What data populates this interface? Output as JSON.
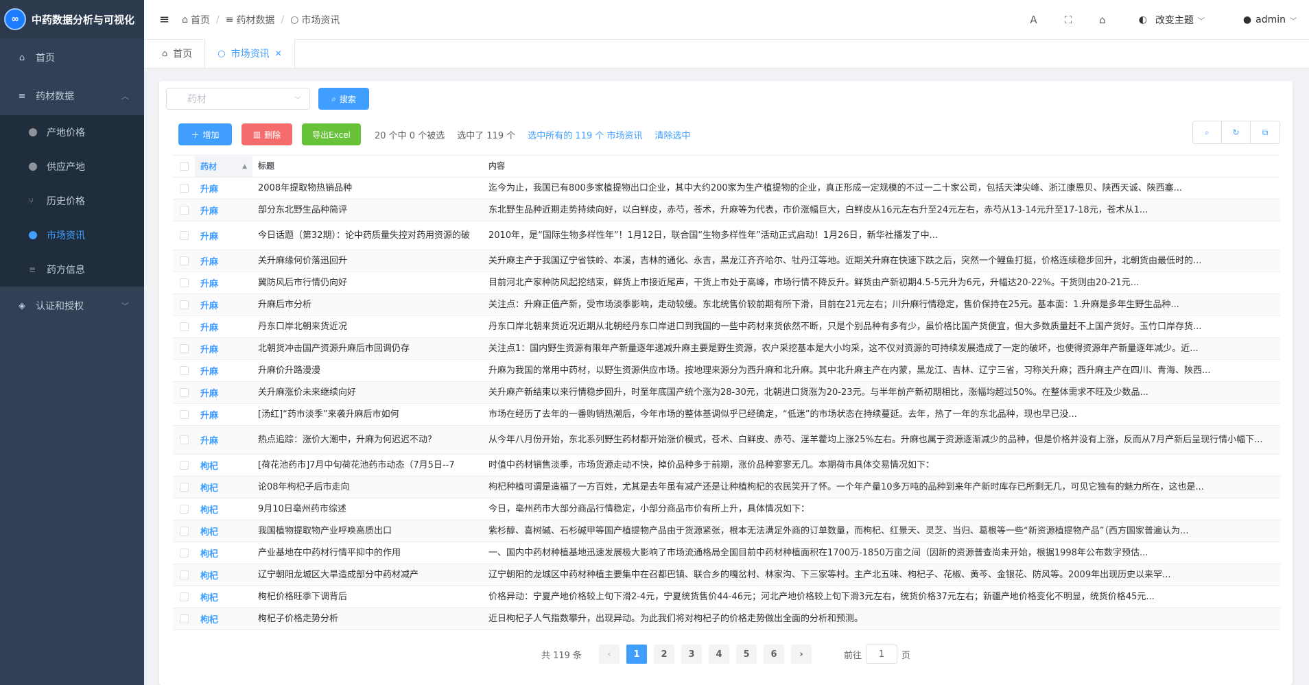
{
  "app": {
    "title": "中药数据分析与可视化",
    "logo_glyph": "∞"
  },
  "sidebar": {
    "items": [
      {
        "label": "首页",
        "icon": "home-icon"
      },
      {
        "label": "药材数据",
        "icon": "database-icon",
        "expanded": true,
        "children": [
          {
            "label": "产地价格"
          },
          {
            "label": "供应产地"
          },
          {
            "label": "历史价格"
          },
          {
            "label": "市场资讯",
            "active": true
          },
          {
            "label": "药方信息"
          }
        ]
      },
      {
        "label": "认证和授权",
        "icon": "shield-icon",
        "expanded": false
      }
    ]
  },
  "topbar": {
    "breadcrumb": [
      "首页",
      "药材数据",
      "市场资讯"
    ],
    "theme_label": "改变主题",
    "user_label": "admin"
  },
  "tags": [
    {
      "label": "首页",
      "active": false
    },
    {
      "label": "市场资讯",
      "active": true
    }
  ],
  "search": {
    "placeholder": "药材",
    "button": "搜索"
  },
  "actions": {
    "add": "增加",
    "delete": "删除",
    "export": "导出Excel",
    "selection_info": "20 个中 0 个被选",
    "selected_total": "选中了 119 个",
    "select_all": "选中所有的 119 个 市场资讯",
    "clear": "清除选中"
  },
  "table": {
    "headers": {
      "medicine": "药材",
      "title": "标题",
      "content": "内容"
    },
    "rows": [
      {
        "medicine": "升麻",
        "title": "2008年提取物热销品种",
        "content": "迄今为止，我国已有800多家植提物出口企业，其中大约200家为生产植提物的企业，真正形成一定规模的不过一二十家公司，包括天津尖峰、浙江康恩贝、陕西天诚、陕西塞..."
      },
      {
        "medicine": "升麻",
        "title": "部分东北野生品种简评",
        "content": "东北野生品种近期走势持续向好，以白鲜皮，赤芍，苍术，升麻等为代表，市价涨幅巨大，白鲜皮从16元左右升至24元左右，赤芍从13-14元升至17-18元，苍术从1..."
      },
      {
        "medicine": "升麻",
        "title": "今日话题（第32期）：论中药质量失控对药用资源的破",
        "content": "2010年，是“国际生物多样性年”！1月12日，联合国“生物多样性年”活动正式启动！1月26日，新华社播发了中..."
      },
      {
        "medicine": "升麻",
        "title": "关升麻缘何价落迅回升",
        "content": "关升麻主产于我国辽宁省铁岭、本溪，吉林的通化、永吉，黑龙江齐齐哈尔、牡丹江等地。近期关升麻在快速下跌之后，突然一个鲤鱼打挺，价格连续稳步回升，北朝货由最低时的..."
      },
      {
        "medicine": "升麻",
        "title": "冀防风后市行情仍向好",
        "content": "目前河北产家种防风起挖结束，鲜货上市接近尾声，干货上市处于高峰，市场行情不降反升。鲜货由产新初期4.5-5元升为6元，升幅达20-22%。干货则由20-21元..."
      },
      {
        "medicine": "升麻",
        "title": "升麻后市分析",
        "content": "关注点：升麻正值产新，受市场淡季影响，走动较缓。东北统售价较前期有所下滑，目前在21元左右；川升麻行情稳定，售价保持在25元。基本面：1.升麻是多年生野生品种..."
      },
      {
        "medicine": "升麻",
        "title": "丹东口岸北朝来货近况",
        "content": "丹东口岸北朝来货近况近期从北朝经丹东口岸进口到我国的一些中药材来货依然不断，只是个别品种有多有少，虽价格比国产货便宜，但大多数质量赶不上国产货好。玉竹口岸存货..."
      },
      {
        "medicine": "升麻",
        "title": "北朝货冲击国产资源升麻后市回调仍存",
        "content": "关注点1：国内野生资源有限年产新量逐年递减升麻主要是野生资源，农户采挖基本是大小均采，这不仅对资源的可持续发展造成了一定的破坏，也使得资源年产新量逐年减少。近..."
      },
      {
        "medicine": "升麻",
        "title": "升麻价升路漫漫",
        "content": "升麻为我国的常用中药材，以野生资源供应市场。按地理来源分为西升麻和北升麻。其中北升麻主产在内蒙，黑龙江、吉林、辽宁三省，习称关升麻；西升麻主产在四川、青海、陕西..."
      },
      {
        "medicine": "升麻",
        "title": "关升麻涨价未来继续向好",
        "content": "关升麻产新结束以来行情稳步回升，时至年底国产统个涨为28-30元，北朝进口货涨为20-23元。与半年前产新初期相比，涨幅均超过50%。在整体需求不旺及少数品..."
      },
      {
        "medicine": "升麻",
        "title": "[汤红]“药市淡季”来袭升麻后市如何",
        "content": "市场在经历了去年的一番购销热潮后，今年市场的整体基调似乎已经确定，“低迷”的市场状态在持续蔓延。去年，热了一年的东北品种，现也早已没..."
      },
      {
        "medicine": "升麻",
        "title": "热点追踪：涨价大潮中，升麻为何迟迟不动?",
        "content": "从今年八月份开始，东北系列野生药材都开始涨价模式，苍术、白鲜皮、赤芍、淫羊藿均上涨25%左右。升麻也属于资源逐渐减少的品种，但是价格并没有上涨，反而从7月产新后呈现行情小幅下..."
      },
      {
        "medicine": "枸杞",
        "title": "[荷花池药市]7月中旬荷花池药市动态（7月5日--7",
        "content": "时值中药材销售淡季，市场货源走动不快，掉价品种多于前期，涨价品种寥寥无几。本期荷市具体交易情况如下："
      },
      {
        "medicine": "枸杞",
        "title": "论08年枸杞子后市走向",
        "content": "枸杞种植可谓是造福了一方百姓，尤其是去年虽有减产还是让种植枸杞的农民笑开了怀。一个年产量10多万吨的品种到来年产新时库存已所剩无几，可见它独有的魅力所在，这也是..."
      },
      {
        "medicine": "枸杞",
        "title": "9月10日亳州药市综述",
        "content": "今日，亳州药市大部分商品行情稳定，小部分商品市价有所上升，具体情况如下："
      },
      {
        "medicine": "枸杞",
        "title": "我国植物提取物产业呼唤高质出口",
        "content": "紫杉醇、喜树碱、石杉碱甲等国产植提物产品由于货源紧张，根本无法满足外商的订单数量，而枸杞、红景天、灵芝、当归、葛根等一些“新资源植提物产品”（西方国家普遍认为..."
      },
      {
        "medicine": "枸杞",
        "title": "产业基地在中药材行情平抑中的作用",
        "content": "一、国内中药材种植基地迅速发展极大影响了市场流通格局全国目前中药材种植面积在1700万-1850万亩之间（因新的资源普查尚未开始，根据1998年公布数字预估..."
      },
      {
        "medicine": "枸杞",
        "title": "辽宁朝阳龙城区大旱造成部分中药材减产",
        "content": "辽宁朝阳的龙城区中药材种植主要集中在召都巴镇、联合乡的嘎岔村、林家沟、下三家等村。主产北五味、枸杞子、花椒、黄芩、金银花、防风等。2009年出现历史以来罕..."
      },
      {
        "medicine": "枸杞",
        "title": "枸杞价格旺季下调背后",
        "content": "价格异动：宁夏产地价格较上旬下滑2-4元，宁夏统货售价44-46元；河北产地价格较上旬下滑3元左右，统货价格37元左右；新疆产地价格变化不明显，统货价格45元..."
      },
      {
        "medicine": "枸杞",
        "title": "枸杞子价格走势分析",
        "content": "近日枸杞子人气指数攀升，出现异动。为此我们将对枸杞子的价格走势做出全面的分析和预测。"
      }
    ]
  },
  "pagination": {
    "total_text": "共 119 条",
    "pages": [
      "1",
      "2",
      "3",
      "4",
      "5",
      "6"
    ],
    "current": "1",
    "goto_prefix": "前往",
    "goto_value": "1",
    "goto_suffix": "页"
  },
  "colors": {
    "sidebar": "#304156",
    "accent": "#409eff",
    "danger": "#f56c6c",
    "success": "#67c23a"
  }
}
